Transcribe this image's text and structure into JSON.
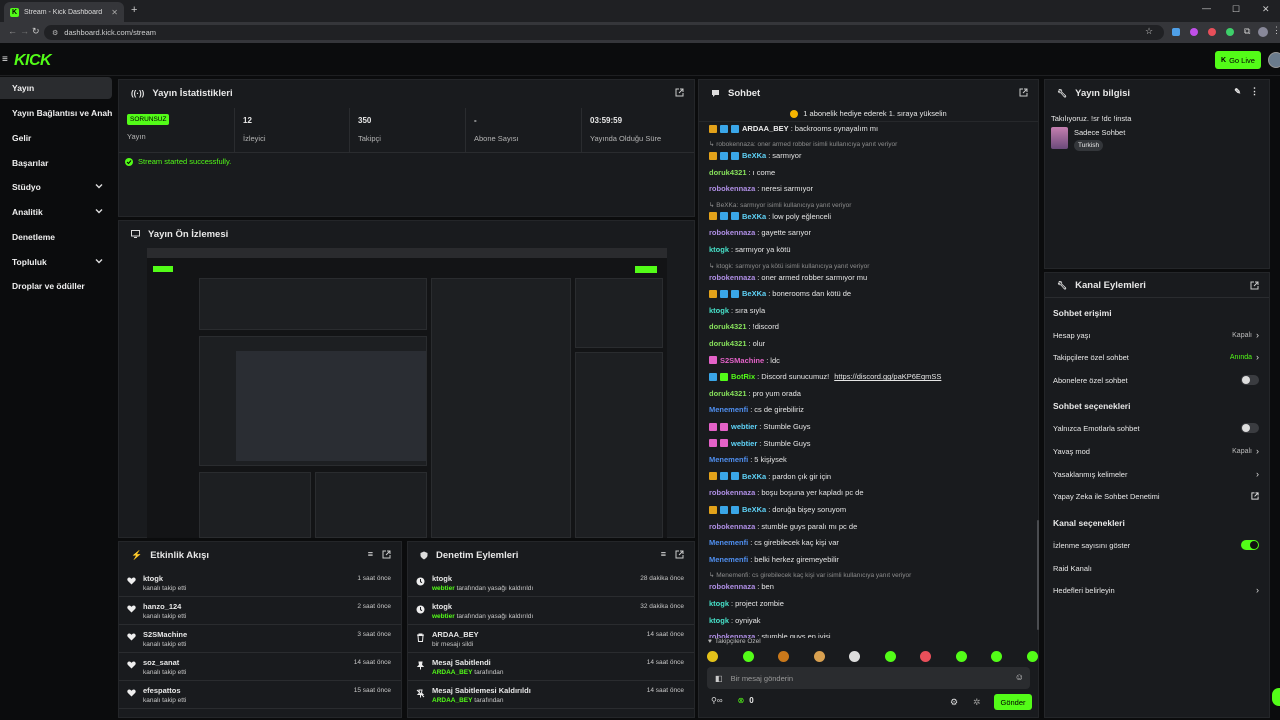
{
  "browser": {
    "tab_title": "Stream - Kick Dashboard",
    "url": "dashboard.kick.com/stream"
  },
  "header": {
    "logo": "KICK",
    "go_live": "Go Live"
  },
  "sidebar": {
    "items": [
      {
        "label": "Yayın",
        "active": true,
        "chevron": false
      },
      {
        "label": "Yayın Bağlantısı ve Anahtarı",
        "chevron": false
      },
      {
        "label": "Gelir",
        "chevron": false
      },
      {
        "label": "Başarılar",
        "chevron": false
      },
      {
        "label": "Stüdyo",
        "chevron": true
      },
      {
        "label": "Analitik",
        "chevron": true
      },
      {
        "label": "Denetleme",
        "chevron": false
      },
      {
        "label": "Topluluk",
        "chevron": true
      },
      {
        "label": "Droplar ve ödüller",
        "chevron": false
      }
    ]
  },
  "stats": {
    "title": "Yayın İstatistikleri",
    "status_badge": "SORUNSUZ",
    "status_label": "Yayın",
    "viewers_value": "12",
    "viewers_label": "İzleyici",
    "followers_value": "350",
    "followers_label": "Takipçi",
    "subs_value": "-",
    "subs_label": "Abone Sayısı",
    "duration_value": "03:59:59",
    "duration_label": "Yayında Olduğu Süre",
    "success_msg": "Stream started successfully."
  },
  "preview": {
    "title": "Yayın Ön İzlemesi"
  },
  "activity": {
    "title": "Etkinlik Akışı",
    "items": [
      {
        "name": "ktogk",
        "sub": "kanalı takip etti",
        "time": "1 saat önce"
      },
      {
        "name": "hanzo_124",
        "sub": "kanalı takip etti",
        "time": "2 saat önce"
      },
      {
        "name": "S2SMachine",
        "sub": "kanalı takip etti",
        "time": "3 saat önce"
      },
      {
        "name": "soz_sanat",
        "sub": "kanalı takip etti",
        "time": "14 saat önce"
      },
      {
        "name": "efespattos",
        "sub": "kanalı takip etti",
        "time": "15 saat önce"
      }
    ]
  },
  "moderation": {
    "title": "Denetim Eylemleri",
    "items": [
      {
        "name": "ktogk",
        "actor": "webtier",
        "sub": "tarafından yasağı kaldırıldı",
        "time": "28 dakika önce",
        "icon": "clock"
      },
      {
        "name": "ktogk",
        "actor": "webtier",
        "sub": "tarafından yasağı kaldırıldı",
        "time": "32 dakika önce",
        "icon": "clock"
      },
      {
        "name": "ARDAA_BEY",
        "actor": "",
        "sub": "bir mesajı sildi",
        "time": "14 saat önce",
        "icon": "trash"
      },
      {
        "name": "Mesaj Sabitlendi",
        "actor": "ARDAA_BEY",
        "sub": "tarafından",
        "time": "14 saat önce",
        "icon": "pin"
      },
      {
        "name": "Mesaj Sabitlemesi Kaldırıldı",
        "actor": "ARDAA_BEY",
        "sub": "tarafından",
        "time": "14 saat önce",
        "icon": "unpin"
      }
    ]
  },
  "chat": {
    "title": "Sohbet",
    "banner": "1 abonelik hediye ederek 1. sıraya yükselin",
    "messages": [
      {
        "kind": "msg",
        "user": "ARDAA_BEY",
        "color": "#f0f0f0",
        "text": "backrooms oynayalım mı",
        "badges": [
          "#e3a21a",
          "#3aa6e8",
          "#3aa6e8"
        ]
      },
      {
        "kind": "reply",
        "text": "robokennaza: oner armed robber isimli kullanıcıya yanıt veriyor"
      },
      {
        "kind": "msg",
        "user": "BeXKa",
        "color": "#5fd3f8",
        "text": "sarmıyor",
        "badges": [
          "#e3a21a",
          "#3aa6e8",
          "#3aa6e8"
        ]
      },
      {
        "kind": "msg",
        "user": "doruk4321",
        "color": "#86e05b",
        "text": "ı come",
        "badges": []
      },
      {
        "kind": "msg",
        "user": "robokennaza",
        "color": "#b08fe6",
        "text": "neresi sarmıyor",
        "badges": []
      },
      {
        "kind": "reply",
        "text": "BeXKa: sarmıyor isimli kullanıcıya yanıt veriyor"
      },
      {
        "kind": "msg",
        "user": "BeXKa",
        "color": "#5fd3f8",
        "text": "low poly eğlenceli",
        "badges": [
          "#e3a21a",
          "#3aa6e8",
          "#3aa6e8"
        ]
      },
      {
        "kind": "msg",
        "user": "robokennaza",
        "color": "#b08fe6",
        "text": "gayette sarıyor",
        "badges": []
      },
      {
        "kind": "msg",
        "user": "ktogk",
        "color": "#46e0c8",
        "text": "sarmıyor ya kötü",
        "badges": []
      },
      {
        "kind": "reply",
        "text": "ktogk: sarmıyor ya kötü isimli kullanıcıya yanıt veriyor"
      },
      {
        "kind": "msg",
        "user": "robokennaza",
        "color": "#b08fe6",
        "text": "oner armed robber sarmıyor mu",
        "badges": []
      },
      {
        "kind": "msg",
        "user": "BeXKa",
        "color": "#5fd3f8",
        "text": "bonerooms dan kötü de",
        "badges": [
          "#e3a21a",
          "#3aa6e8",
          "#3aa6e8"
        ]
      },
      {
        "kind": "msg",
        "user": "ktogk",
        "color": "#46e0c8",
        "text": "sıra sıyla",
        "badges": []
      },
      {
        "kind": "msg",
        "user": "doruk4321",
        "color": "#86e05b",
        "text": "!discord",
        "badges": []
      },
      {
        "kind": "msg",
        "user": "doruk4321",
        "color": "#86e05b",
        "text": "olur",
        "badges": []
      },
      {
        "kind": "msg",
        "user": "S2SMachine",
        "color": "#e462c8",
        "text": "ldc",
        "badges": [
          "#e462c8"
        ]
      },
      {
        "kind": "msg",
        "user": "BotRix",
        "color": "#53fc18",
        "text": "Discord sunucumuz!",
        "link": "https://discord.gg/paKP6EqmSS",
        "badges": [
          "#3aa6e8",
          "#53fc18"
        ]
      },
      {
        "kind": "msg",
        "user": "doruk4321",
        "color": "#86e05b",
        "text": "pro yum orada",
        "badges": []
      },
      {
        "kind": "msg",
        "user": "Menemenfi",
        "color": "#4f8ff0",
        "text": "cs de girebiliriz",
        "badges": []
      },
      {
        "kind": "msg",
        "user": "webtier",
        "color": "#5fd3f8",
        "text": "Stumble Guys",
        "badges": [
          "#e462c8",
          "#e462c8"
        ]
      },
      {
        "kind": "msg",
        "user": "webtier",
        "color": "#5fd3f8",
        "text": "Stumble Guys",
        "badges": [
          "#e462c8",
          "#e462c8"
        ]
      },
      {
        "kind": "msg",
        "user": "Menemenfi",
        "color": "#4f8ff0",
        "text": "5 kişiysek",
        "badges": []
      },
      {
        "kind": "msg",
        "user": "BeXKa",
        "color": "#5fd3f8",
        "text": "pardon çık gir için",
        "badges": [
          "#e3a21a",
          "#3aa6e8",
          "#3aa6e8"
        ]
      },
      {
        "kind": "msg",
        "user": "robokennaza",
        "color": "#b08fe6",
        "text": "boşu boşuna yer kapladı pc de",
        "badges": []
      },
      {
        "kind": "msg",
        "user": "BeXKa",
        "color": "#5fd3f8",
        "text": "doruğa bişey soruyom",
        "badges": [
          "#e3a21a",
          "#3aa6e8",
          "#3aa6e8"
        ]
      },
      {
        "kind": "msg",
        "user": "robokennaza",
        "color": "#b08fe6",
        "text": "stumble guys paralı mı pc de",
        "badges": []
      },
      {
        "kind": "msg",
        "user": "Menemenfi",
        "color": "#4f8ff0",
        "text": "cs girebilecek kaç kişi var",
        "badges": []
      },
      {
        "kind": "msg",
        "user": "Menemenfi",
        "color": "#4f8ff0",
        "text": "belki herkez giremeyebilir",
        "badges": []
      },
      {
        "kind": "reply",
        "text": "Menemenfi: cs girebilecek kaç kişi var isimli kullanıcıya yanıt veriyor"
      },
      {
        "kind": "msg",
        "user": "robokennaza",
        "color": "#b08fe6",
        "text": "ben",
        "badges": []
      },
      {
        "kind": "msg",
        "user": "ktogk",
        "color": "#46e0c8",
        "text": "project zombie",
        "badges": []
      },
      {
        "kind": "msg",
        "user": "ktogk",
        "color": "#46e0c8",
        "text": "oyniyak",
        "badges": []
      },
      {
        "kind": "msg",
        "user": "robokennaza",
        "color": "#b08fe6",
        "text": "stumble guys en iyisi",
        "badges": []
      }
    ],
    "followers_only": "Takipçilere Özel",
    "input_placeholder": "Bir mesaj gönderin",
    "count": "0",
    "send": "Gönder"
  },
  "stream_info": {
    "title": "Yayın bilgisi",
    "stream_title": "Takılıyoruz. !sr !dc !insta",
    "category": "Sadece Sohbet",
    "tag": "Turkish"
  },
  "channel_actions": {
    "title": "Kanal Eylemleri",
    "chat_access": "Sohbet erişimi",
    "account_age": "Hesap yaşı",
    "account_age_val": "Kapalı",
    "followers_chat": "Takipçilere özel sohbet",
    "followers_chat_val": "Anında",
    "subs_chat": "Abonelere özel sohbet",
    "chat_options": "Sohbet seçenekleri",
    "emote_only": "Yalnızca Emotlarla sohbet",
    "slow_mode": "Yavaş mod",
    "slow_mode_val": "Kapalı",
    "banned_words": "Yasaklanmış kelimeler",
    "ai_mod": "Yapay Zeka ile Sohbet Denetimi",
    "channel_options": "Kanal seçenekleri",
    "show_viewers": "İzlenme sayısını göster",
    "raid": "Raid Kanalı",
    "goals": "Hedefleri belirleyin"
  },
  "colors": {
    "accent": "#53fc18",
    "panel": "#191b1e",
    "background": "#0b0c0d"
  }
}
